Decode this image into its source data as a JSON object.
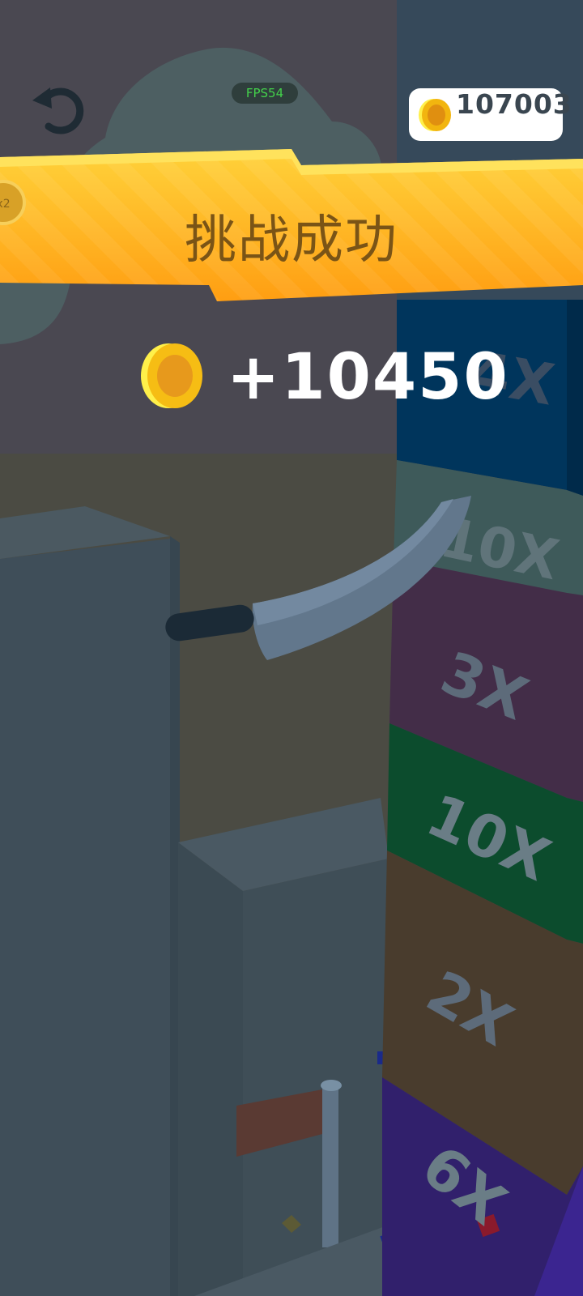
{
  "hud": {
    "fps": "FPS54",
    "coin_balance": "107003"
  },
  "banner": {
    "title": "挑战成功",
    "side_badge": "x2"
  },
  "reward": {
    "amount": "+10450"
  },
  "multiplier_blocks": [
    {
      "label": "4X",
      "color": "#00355c"
    },
    {
      "label": "10X",
      "color": "#3e5a5a"
    },
    {
      "label": "3X",
      "color": "#432d48"
    },
    {
      "label": "10X",
      "color": "#0c4c2d"
    },
    {
      "label": "2X",
      "color": "#493c2d"
    },
    {
      "label": "6X",
      "color": "#31206c"
    }
  ],
  "colors": {
    "banner": "#ffb31a",
    "coin": "#f7c21a",
    "fps_text": "#43d14b"
  }
}
